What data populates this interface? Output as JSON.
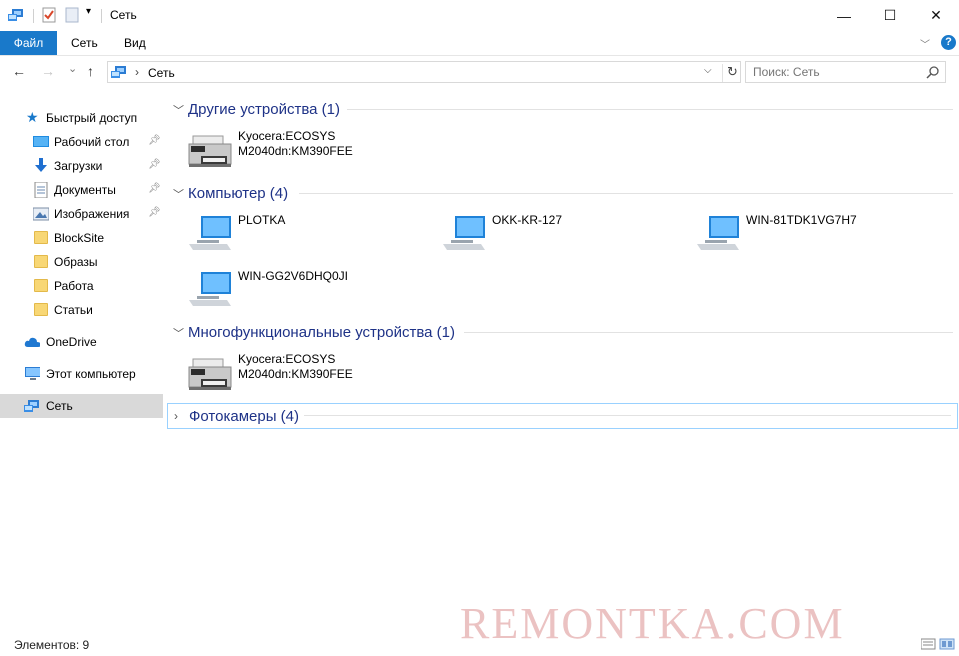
{
  "window": {
    "title": "Сеть",
    "minimize": "—",
    "maximize": "☐",
    "close": "✕"
  },
  "ribbon": {
    "tabs": [
      "Файл",
      "Сеть",
      "Вид"
    ],
    "help": "?"
  },
  "nav": {
    "back": "←",
    "forward": "→",
    "recent": "⌄",
    "up": "↑",
    "address_path": "Сеть",
    "address_separator": "›",
    "search_placeholder": "Поиск: Сеть"
  },
  "sidebar": {
    "quick_access": "Быстрый доступ",
    "items": [
      {
        "label": "Рабочий стол",
        "icon": "desktop-icon",
        "pinned": true
      },
      {
        "label": "Загрузки",
        "icon": "download-icon",
        "pinned": true
      },
      {
        "label": "Документы",
        "icon": "document-icon",
        "pinned": true
      },
      {
        "label": "Изображения",
        "icon": "pictures-icon",
        "pinned": true
      },
      {
        "label": "BlockSite",
        "icon": "folder-icon",
        "pinned": false
      },
      {
        "label": "Образы",
        "icon": "folder-icon",
        "pinned": false
      },
      {
        "label": "Работа",
        "icon": "folder-icon",
        "pinned": false
      },
      {
        "label": "Статьи",
        "icon": "folder-icon",
        "pinned": false
      }
    ],
    "onedrive": "OneDrive",
    "this_pc": "Этот компьютер",
    "network": "Сеть"
  },
  "groups": [
    {
      "title": "Другие устройства (1)",
      "items": [
        {
          "name_line1": "Kyocera:ECOSYS",
          "name_line2": "M2040dn:KM390FEE",
          "icon": "printer-icon"
        }
      ]
    },
    {
      "title": "Компьютер (4)",
      "items": [
        {
          "name": "PLOTKA",
          "icon": "computer-icon"
        },
        {
          "name": "OKK-KR-127",
          "icon": "computer-icon"
        },
        {
          "name": "WIN-81TDK1VG7H7",
          "icon": "computer-icon"
        },
        {
          "name": "WIN-GG2V6DHQ0JI",
          "icon": "computer-icon"
        }
      ]
    },
    {
      "title": "Многофункциональные устройства (1)",
      "items": [
        {
          "name_line1": "Kyocera:ECOSYS",
          "name_line2": "M2040dn:KM390FEE",
          "icon": "printer-icon"
        }
      ]
    },
    {
      "title": "Фотокамеры (4)",
      "collapsed": true,
      "items": []
    }
  ],
  "status": {
    "items_count": "Элементов: 9"
  },
  "watermark": "REMONTKA.COM",
  "colors": {
    "accent": "#1979ca",
    "group_title": "#1e3287",
    "selected_bg": "#d9d9d9"
  }
}
